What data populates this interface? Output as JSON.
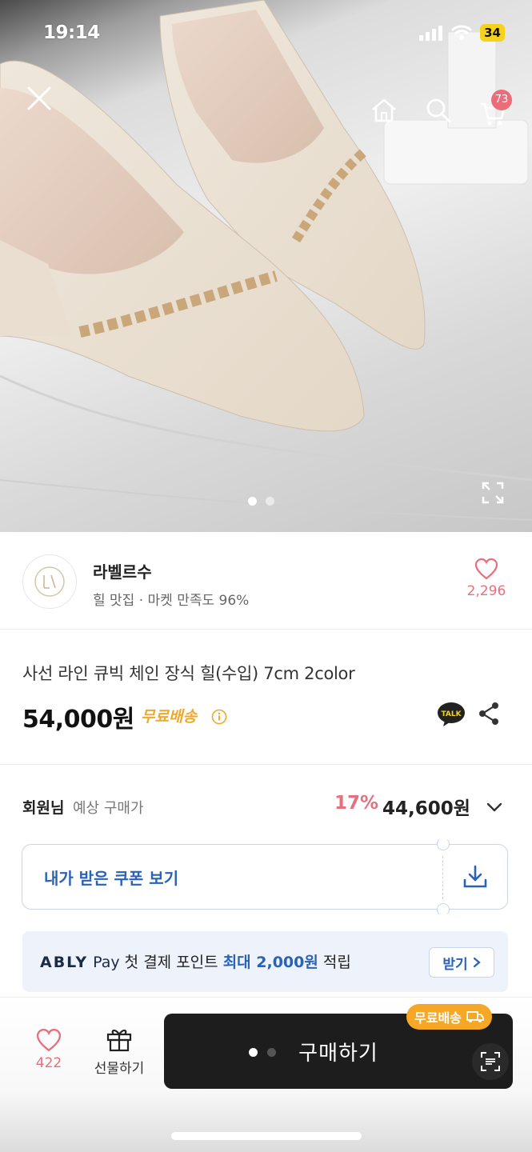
{
  "status_bar": {
    "time": "19:14",
    "battery": "34"
  },
  "hero": {
    "close_icon": "close-icon",
    "nav_icons": [
      "home-icon",
      "search-icon",
      "cart-icon"
    ],
    "cart_badge": "73",
    "image_count": 2,
    "current_image": 1
  },
  "seller": {
    "name": "라벨르수",
    "subtitle": "힐 맛집 · 마켓 만족도 96%",
    "like_count": "2,296"
  },
  "product": {
    "title": "사선 라인 큐빅 체인 장식 힐(수입) 7cm 2color",
    "price": "54,000원",
    "shipping": "무료배송"
  },
  "member_price": {
    "label": "회원님",
    "sub_label": "예상 구매가",
    "discount": "17%",
    "price": "44,600원"
  },
  "coupon": {
    "label": "내가 받은 쿠폰 보기"
  },
  "ably_pay": {
    "brand": "ABLY",
    "pay": "Pay",
    "text_before": " 첫 결제 포인트 ",
    "highlight": "최대 2,000원",
    "text_after": " 적립",
    "button": "받기"
  },
  "bottom_bar": {
    "wish_count": "422",
    "gift_label": "선물하기",
    "buy_label": "구매하기",
    "shipping_badge": "무료배송"
  },
  "colors": {
    "accent_pink": "#e7707f",
    "link_blue": "#2a62b5",
    "shipping_orange": "#f5a826",
    "buy_button": "#1d1d1d"
  }
}
